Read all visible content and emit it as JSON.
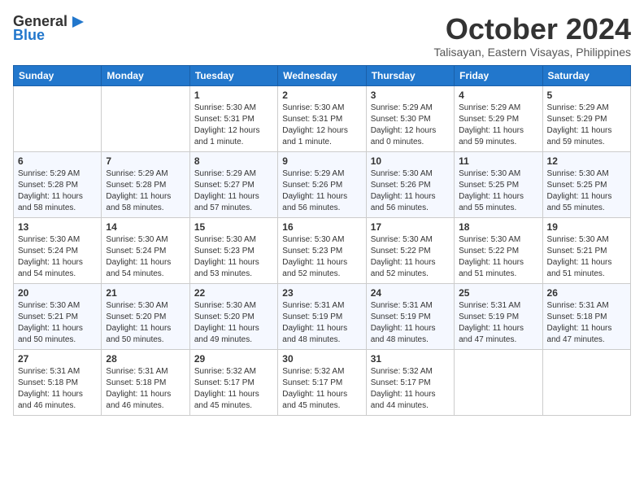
{
  "logo": {
    "general": "General",
    "blue": "Blue"
  },
  "title": "October 2024",
  "location": "Talisayan, Eastern Visayas, Philippines",
  "days_of_week": [
    "Sunday",
    "Monday",
    "Tuesday",
    "Wednesday",
    "Thursday",
    "Friday",
    "Saturday"
  ],
  "weeks": [
    [
      {
        "day": "",
        "detail": ""
      },
      {
        "day": "",
        "detail": ""
      },
      {
        "day": "1",
        "detail": "Sunrise: 5:30 AM\nSunset: 5:31 PM\nDaylight: 12 hours\nand 1 minute."
      },
      {
        "day": "2",
        "detail": "Sunrise: 5:30 AM\nSunset: 5:31 PM\nDaylight: 12 hours\nand 1 minute."
      },
      {
        "day": "3",
        "detail": "Sunrise: 5:29 AM\nSunset: 5:30 PM\nDaylight: 12 hours\nand 0 minutes."
      },
      {
        "day": "4",
        "detail": "Sunrise: 5:29 AM\nSunset: 5:29 PM\nDaylight: 11 hours\nand 59 minutes."
      },
      {
        "day": "5",
        "detail": "Sunrise: 5:29 AM\nSunset: 5:29 PM\nDaylight: 11 hours\nand 59 minutes."
      }
    ],
    [
      {
        "day": "6",
        "detail": "Sunrise: 5:29 AM\nSunset: 5:28 PM\nDaylight: 11 hours\nand 58 minutes."
      },
      {
        "day": "7",
        "detail": "Sunrise: 5:29 AM\nSunset: 5:28 PM\nDaylight: 11 hours\nand 58 minutes."
      },
      {
        "day": "8",
        "detail": "Sunrise: 5:29 AM\nSunset: 5:27 PM\nDaylight: 11 hours\nand 57 minutes."
      },
      {
        "day": "9",
        "detail": "Sunrise: 5:29 AM\nSunset: 5:26 PM\nDaylight: 11 hours\nand 56 minutes."
      },
      {
        "day": "10",
        "detail": "Sunrise: 5:30 AM\nSunset: 5:26 PM\nDaylight: 11 hours\nand 56 minutes."
      },
      {
        "day": "11",
        "detail": "Sunrise: 5:30 AM\nSunset: 5:25 PM\nDaylight: 11 hours\nand 55 minutes."
      },
      {
        "day": "12",
        "detail": "Sunrise: 5:30 AM\nSunset: 5:25 PM\nDaylight: 11 hours\nand 55 minutes."
      }
    ],
    [
      {
        "day": "13",
        "detail": "Sunrise: 5:30 AM\nSunset: 5:24 PM\nDaylight: 11 hours\nand 54 minutes."
      },
      {
        "day": "14",
        "detail": "Sunrise: 5:30 AM\nSunset: 5:24 PM\nDaylight: 11 hours\nand 54 minutes."
      },
      {
        "day": "15",
        "detail": "Sunrise: 5:30 AM\nSunset: 5:23 PM\nDaylight: 11 hours\nand 53 minutes."
      },
      {
        "day": "16",
        "detail": "Sunrise: 5:30 AM\nSunset: 5:23 PM\nDaylight: 11 hours\nand 52 minutes."
      },
      {
        "day": "17",
        "detail": "Sunrise: 5:30 AM\nSunset: 5:22 PM\nDaylight: 11 hours\nand 52 minutes."
      },
      {
        "day": "18",
        "detail": "Sunrise: 5:30 AM\nSunset: 5:22 PM\nDaylight: 11 hours\nand 51 minutes."
      },
      {
        "day": "19",
        "detail": "Sunrise: 5:30 AM\nSunset: 5:21 PM\nDaylight: 11 hours\nand 51 minutes."
      }
    ],
    [
      {
        "day": "20",
        "detail": "Sunrise: 5:30 AM\nSunset: 5:21 PM\nDaylight: 11 hours\nand 50 minutes."
      },
      {
        "day": "21",
        "detail": "Sunrise: 5:30 AM\nSunset: 5:20 PM\nDaylight: 11 hours\nand 50 minutes."
      },
      {
        "day": "22",
        "detail": "Sunrise: 5:30 AM\nSunset: 5:20 PM\nDaylight: 11 hours\nand 49 minutes."
      },
      {
        "day": "23",
        "detail": "Sunrise: 5:31 AM\nSunset: 5:19 PM\nDaylight: 11 hours\nand 48 minutes."
      },
      {
        "day": "24",
        "detail": "Sunrise: 5:31 AM\nSunset: 5:19 PM\nDaylight: 11 hours\nand 48 minutes."
      },
      {
        "day": "25",
        "detail": "Sunrise: 5:31 AM\nSunset: 5:19 PM\nDaylight: 11 hours\nand 47 minutes."
      },
      {
        "day": "26",
        "detail": "Sunrise: 5:31 AM\nSunset: 5:18 PM\nDaylight: 11 hours\nand 47 minutes."
      }
    ],
    [
      {
        "day": "27",
        "detail": "Sunrise: 5:31 AM\nSunset: 5:18 PM\nDaylight: 11 hours\nand 46 minutes."
      },
      {
        "day": "28",
        "detail": "Sunrise: 5:31 AM\nSunset: 5:18 PM\nDaylight: 11 hours\nand 46 minutes."
      },
      {
        "day": "29",
        "detail": "Sunrise: 5:32 AM\nSunset: 5:17 PM\nDaylight: 11 hours\nand 45 minutes."
      },
      {
        "day": "30",
        "detail": "Sunrise: 5:32 AM\nSunset: 5:17 PM\nDaylight: 11 hours\nand 45 minutes."
      },
      {
        "day": "31",
        "detail": "Sunrise: 5:32 AM\nSunset: 5:17 PM\nDaylight: 11 hours\nand 44 minutes."
      },
      {
        "day": "",
        "detail": ""
      },
      {
        "day": "",
        "detail": ""
      }
    ]
  ]
}
